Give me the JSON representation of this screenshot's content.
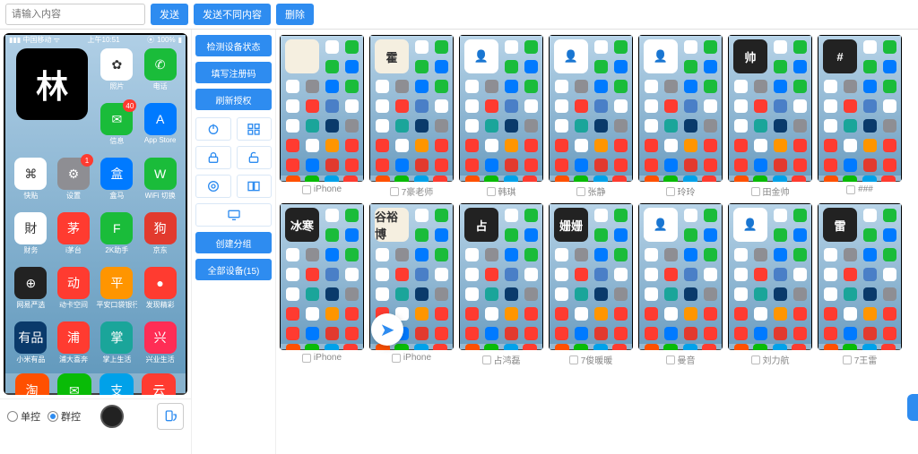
{
  "topbar": {
    "input_placeholder": "请输入内容",
    "send": "发送",
    "send_diff": "发送不同内容",
    "delete": "删除"
  },
  "tools": {
    "check_status": "检测设备状态",
    "fill_register": "填写注册码",
    "refresh_auth": "刷新授权",
    "create_group": "创建分组",
    "all_devices": "全部设备(15)"
  },
  "preview": {
    "carrier": "中国移动",
    "time": "上午10:51",
    "battery": "100%",
    "widget": "林",
    "apps": [
      {
        "label": "照片",
        "bg": "c-white",
        "glyph": "✿"
      },
      {
        "label": "电话",
        "bg": "c-green",
        "glyph": "✆"
      },
      {
        "label": "信息",
        "bg": "c-green",
        "glyph": "✉",
        "badge": "40"
      },
      {
        "label": "App Store",
        "bg": "c-blue",
        "glyph": "A"
      },
      {
        "label": "快贴",
        "bg": "c-white",
        "glyph": "⌘"
      },
      {
        "label": "设置",
        "bg": "c-grey",
        "glyph": "⚙",
        "badge": "1"
      },
      {
        "label": "盒马",
        "bg": "c-blue",
        "glyph": "盒"
      },
      {
        "label": "WiFi 切换",
        "bg": "c-green",
        "glyph": "W"
      },
      {
        "label": "财务",
        "bg": "c-white",
        "glyph": "財"
      },
      {
        "label": "i茅台",
        "bg": "c-red",
        "glyph": "茅"
      },
      {
        "label": "2K助手",
        "bg": "c-green",
        "glyph": "F"
      },
      {
        "label": "京东",
        "bg": "c-jd",
        "glyph": "狗"
      },
      {
        "label": "网易严选",
        "bg": "c-dark",
        "glyph": "⊕"
      },
      {
        "label": "动卡空间",
        "bg": "c-red",
        "glyph": "动"
      },
      {
        "label": "平安口袋银行",
        "bg": "c-orange",
        "glyph": "平"
      },
      {
        "label": "发现精彩",
        "bg": "c-red",
        "glyph": "●"
      },
      {
        "label": "小米有品",
        "bg": "c-dblue",
        "glyph": "有品"
      },
      {
        "label": "浦大喜奔",
        "bg": "c-red",
        "glyph": "浦"
      },
      {
        "label": "掌上生活",
        "bg": "c-teal",
        "glyph": "掌"
      },
      {
        "label": "兴业生活",
        "bg": "c-pink",
        "glyph": "兴"
      }
    ],
    "dock": [
      {
        "bg": "c-tao",
        "glyph": "淘"
      },
      {
        "bg": "c-wc",
        "glyph": "✉"
      },
      {
        "bg": "c-ali",
        "glyph": "支"
      },
      {
        "bg": "c-red",
        "glyph": "云"
      }
    ],
    "mode_single": "单控",
    "mode_group": "群控"
  },
  "devices_row1": [
    {
      "label": "iPhone",
      "widget": "",
      "wbg": "c-cream"
    },
    {
      "label": "7豪老师",
      "widget": "霍",
      "wbg": "c-cream"
    },
    {
      "label": "韩琪",
      "widget": "",
      "wbg": "c-white",
      "avatar": true
    },
    {
      "label": "张静",
      "widget": "",
      "wbg": "c-white",
      "avatar": true
    },
    {
      "label": "玲玲",
      "widget": "",
      "wbg": "c-white",
      "avatar": true
    },
    {
      "label": "田金帅",
      "widget": "帅",
      "wbg": "c-dark"
    },
    {
      "label": "###",
      "widget": "#",
      "wbg": "c-dark"
    }
  ],
  "devices_row2": [
    {
      "label": "iPhone",
      "widget": "冰寒",
      "wbg": "c-dark"
    },
    {
      "label": "iPhone",
      "widget": "谷裕博",
      "wbg": "c-cream"
    },
    {
      "label": "占鸿磊",
      "widget": "占",
      "wbg": "c-dark"
    },
    {
      "label": "7俊暖暖",
      "widget": "姗姗",
      "wbg": "c-dark"
    },
    {
      "label": "曼音",
      "widget": "",
      "wbg": "c-white",
      "avatar": true
    },
    {
      "label": "刘力航",
      "widget": "",
      "wbg": "c-white",
      "avatar": true
    },
    {
      "label": "7王雷",
      "widget": "雷",
      "wbg": "c-dark"
    }
  ],
  "thumb_icon_colors": [
    "c-white",
    "c-green",
    "c-green",
    "c-blue",
    "c-white",
    "c-grey",
    "c-blue",
    "c-green",
    "c-white",
    "c-red",
    "c-nav",
    "c-white",
    "c-white",
    "c-teal",
    "c-dblue",
    "c-grey",
    "c-red",
    "c-white",
    "c-orange",
    "c-red",
    "c-red",
    "c-blue",
    "c-jd",
    "c-red"
  ],
  "thumb_dock_colors": [
    "c-tao",
    "c-wc",
    "c-ali",
    "c-red"
  ]
}
